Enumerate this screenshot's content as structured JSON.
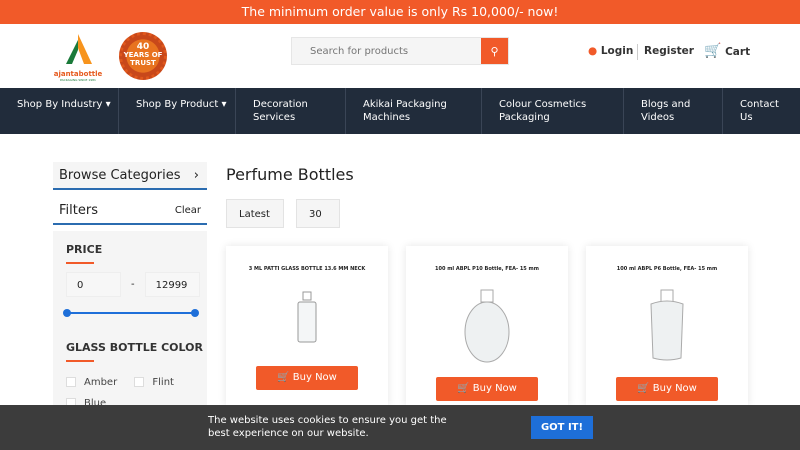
{
  "topbar": {
    "message": "The minimum order value is only Rs 10,000/- now!"
  },
  "header": {
    "logo_text": "ajantabottle",
    "logo_sub": "PACKAGING SINCE 1981",
    "badge_num": "40",
    "badge_text": "YEARS OF TRUST",
    "search_placeholder": "Search for products",
    "login": "Login",
    "register": "Register",
    "cart": "Cart"
  },
  "nav": [
    "Shop By Industry",
    "Shop By Product",
    "Decoration Services",
    "Akikai Packaging Machines",
    "Colour Cosmetics Packaging",
    "Blogs and Videos",
    "Contact Us"
  ],
  "sidebar": {
    "browse": "Browse Categories",
    "filters": "Filters",
    "clear": "Clear",
    "price_title": "PRICE",
    "price_min": "0",
    "price_max": "12999",
    "price_sep": "-",
    "color_title": "GLASS BOTTLE COLOR",
    "colors": [
      "Amber",
      "Flint",
      "Blue"
    ]
  },
  "main": {
    "title": "Perfume Bottles",
    "sort": "Latest",
    "per_page": "30"
  },
  "products": [
    {
      "name": "3 ML PATTI GLASS BOTTLE 13.6 MM NECK",
      "buy": "Buy Now"
    },
    {
      "name": "100 ml ABPL P10 Bottle, FEA- 15 mm",
      "buy": "Buy Now"
    },
    {
      "name": "100 ml ABPL P6 Bottle, FEA- 15 mm",
      "buy": "Buy Now"
    }
  ],
  "cookie": {
    "text": "The website uses cookies to ensure you get the best experience on our website.",
    "button": "GOT IT!"
  },
  "colors": {
    "accent": "#f15a29",
    "nav": "#212c3b",
    "cookie_btn": "#1e6fd9"
  }
}
